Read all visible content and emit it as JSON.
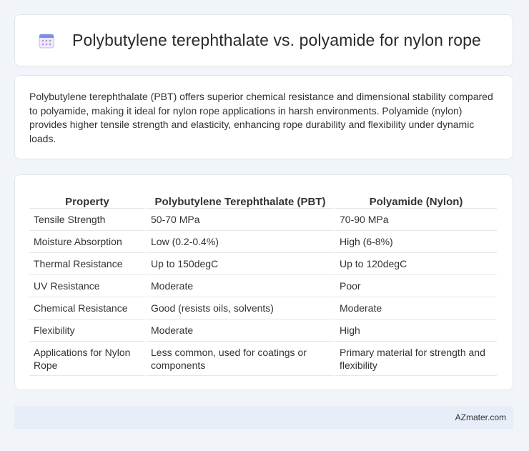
{
  "header": {
    "icon": "calendar-icon",
    "title": "Polybutylene terephthalate vs. polyamide for nylon rope"
  },
  "summary": {
    "text": "Polybutylene terephthalate (PBT) offers superior chemical resistance and dimensional stability compared to polyamide, making it ideal for nylon rope applications in harsh environments. Polyamide (nylon) provides higher tensile strength and elasticity, enhancing rope durability and flexibility under dynamic loads."
  },
  "table": {
    "headers": [
      "Property",
      "Polybutylene Terephthalate (PBT)",
      "Polyamide (Nylon)"
    ],
    "rows": [
      [
        "Tensile Strength",
        "50-70 MPa",
        "70-90 MPa"
      ],
      [
        "Moisture Absorption",
        "Low (0.2-0.4%)",
        "High (6-8%)"
      ],
      [
        "Thermal Resistance",
        "Up to 150degC",
        "Up to 120degC"
      ],
      [
        "UV Resistance",
        "Moderate",
        "Poor"
      ],
      [
        "Chemical Resistance",
        "Good (resists oils, solvents)",
        "Moderate"
      ],
      [
        "Flexibility",
        "Moderate",
        "High"
      ],
      [
        "Applications for Nylon Rope",
        "Less common, used for coatings or components",
        "Primary material for strength and flexibility"
      ]
    ]
  },
  "footer": {
    "text": "AZmater.com"
  },
  "colors": {
    "background": "#f1f4f9",
    "card": "#ffffff",
    "footer": "#e8eef7",
    "icon_accent": "#6c7fd8"
  }
}
